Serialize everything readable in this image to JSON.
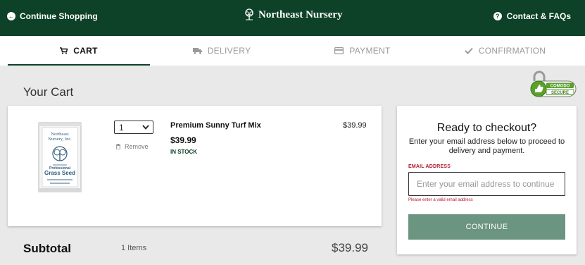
{
  "header": {
    "continue_shopping": "Continue Shopping",
    "brand": "Northeast Nursery",
    "contact": "Contact & FAQs"
  },
  "steps": [
    {
      "label": "CART",
      "icon": "cart-icon",
      "active": true
    },
    {
      "label": "DELIVERY",
      "icon": "truck-icon",
      "active": false
    },
    {
      "label": "PAYMENT",
      "icon": "credit-card-icon",
      "active": false
    },
    {
      "label": "CONFIRMATION",
      "icon": "check-icon",
      "active": false
    }
  ],
  "cart": {
    "title": "Your Cart",
    "item": {
      "bag_brand_line1": "Northeast",
      "bag_brand_line2": "Nursery, Inc.",
      "bag_professional": "Professional",
      "bag_product": "Grass Seed",
      "quantity": "1",
      "remove_label": "Remove",
      "name": "Premium Sunny Turf Mix",
      "price": "$39.99",
      "stock": "IN STOCK",
      "line_total": "$39.99"
    },
    "subtotal": {
      "label": "Subtotal",
      "count": "1 Items",
      "value": "$39.99"
    }
  },
  "security_badge": {
    "line1": "COMODO",
    "line2": "SECURE"
  },
  "checkout": {
    "title": "Ready to checkout?",
    "description": "Enter your email address below to proceed to delivery and payment.",
    "email_label": "EMAIL ADDRESS",
    "email_placeholder": "Enter your email address to continue",
    "email_value": "",
    "error": "Please enter a valid email address",
    "button": "CONTINUE"
  },
  "colors": {
    "brand_green": "#0d4128",
    "button_green": "#6b9580",
    "error_red": "#b3172f"
  }
}
